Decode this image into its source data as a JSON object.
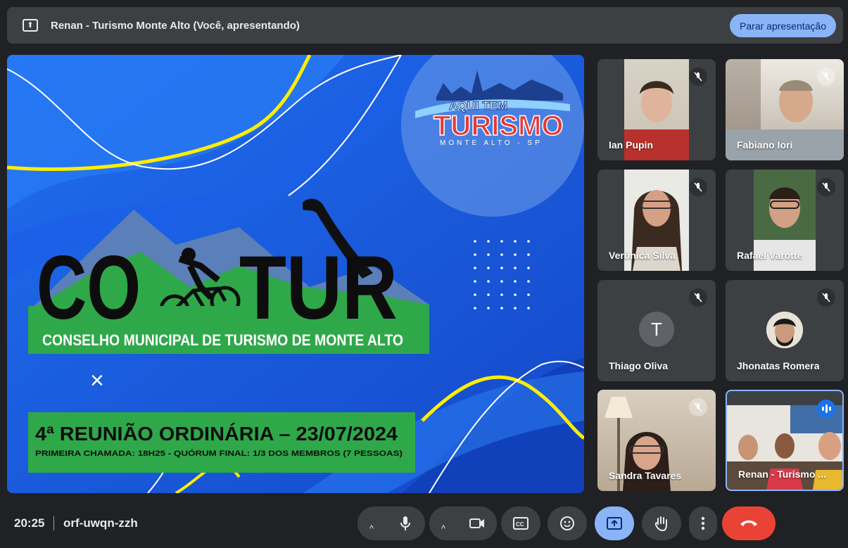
{
  "topbar": {
    "title": "Renan - Turismo Monte Alto (Você, apresentando)",
    "stop_label": "Parar apresentação"
  },
  "slide": {
    "logo_line1": "AQUI TEM",
    "logo_line2": "TURISMO",
    "logo_line3": "MONTE ALTO - SP",
    "title_left": "CO",
    "title_right": "TUR",
    "subtitle": "CONSELHO MUNICIPAL DE TURISMO DE MONTE ALTO",
    "close_mark": "×",
    "meeting_title": "4ª REUNIÃO ORDINÁRIA – 23/07/2024",
    "meeting_details": "PRIMEIRA CHAMADA: 18H25 - QUÓRUM FINAL: 1/3 DOS MEMBROS (7 PESSOAS)"
  },
  "participants": [
    {
      "name": "Ian Pupin",
      "muted": true
    },
    {
      "name": "Fabiano Iori",
      "muted": true
    },
    {
      "name": "Verônica Silva",
      "muted": true
    },
    {
      "name": "Rafael Varotte",
      "muted": true
    },
    {
      "name": "Thiago Oliva",
      "muted": true,
      "initial": "T"
    },
    {
      "name": "Jhonatas Romera",
      "muted": true
    },
    {
      "name": "Sandra Tavares",
      "muted": true
    },
    {
      "name": "Renan - Turismo ...",
      "muted": false,
      "speaking": true
    }
  ],
  "bottom": {
    "time": "20:25",
    "meeting_code": "orf-uwqn-zzh",
    "caret": "^"
  },
  "colors": {
    "accent": "#8ab4f8",
    "end_call": "#ea4335",
    "slide_blue": "#1f5fe0",
    "green_band": "#2fa84a",
    "yellow": "#ffee00"
  }
}
